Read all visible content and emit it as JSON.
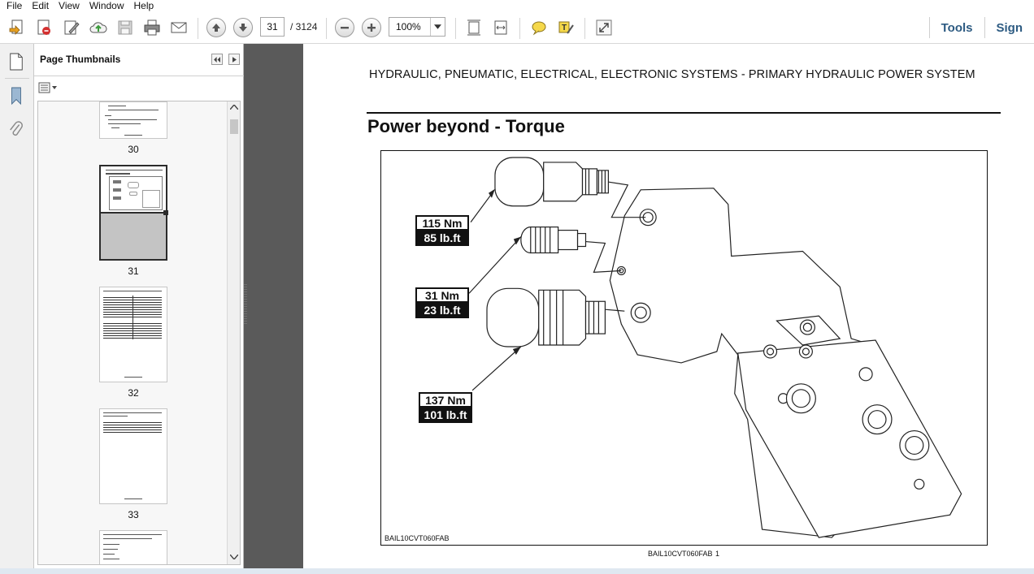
{
  "menu": [
    "File",
    "Edit",
    "View",
    "Window",
    "Help"
  ],
  "toolbar": {
    "current_page": "31",
    "page_total": "/ 3124",
    "zoom": "100%",
    "tools_label": "Tools",
    "sign_label": "Sign",
    "icons": [
      "create-pdf-icon",
      "export-icon",
      "edit-icon",
      "cloud-upload-icon",
      "save-icon",
      "print-icon",
      "email-icon",
      "previous-page-icon",
      "next-page-icon",
      "zoom-out-icon",
      "zoom-in-icon",
      "fit-page-icon",
      "fit-width-icon",
      "comment-icon",
      "highlight-icon",
      "read-mode-icon"
    ]
  },
  "sidebar": {
    "panel_title": "Page Thumbnails",
    "thumbnails": [
      {
        "label": "30"
      },
      {
        "label": "31",
        "selected": true
      },
      {
        "label": "32"
      },
      {
        "label": "33"
      }
    ]
  },
  "document": {
    "header": "HYDRAULIC, PNEUMATIC, ELECTRICAL, ELECTRONIC SYSTEMS - PRIMARY HYDRAULIC POWER SYSTEM",
    "title": "Power beyond - Torque",
    "figure_code": "BAIL10CVT060FAB",
    "caption": "BAIL10CVT060FAB",
    "caption_number": "1",
    "torques": [
      {
        "nm": "115 Nm",
        "lbft": "85 lb.ft"
      },
      {
        "nm": "31 Nm",
        "lbft": "23 lb.ft"
      },
      {
        "nm": "137 Nm",
        "lbft": "101 lb.ft"
      }
    ]
  }
}
